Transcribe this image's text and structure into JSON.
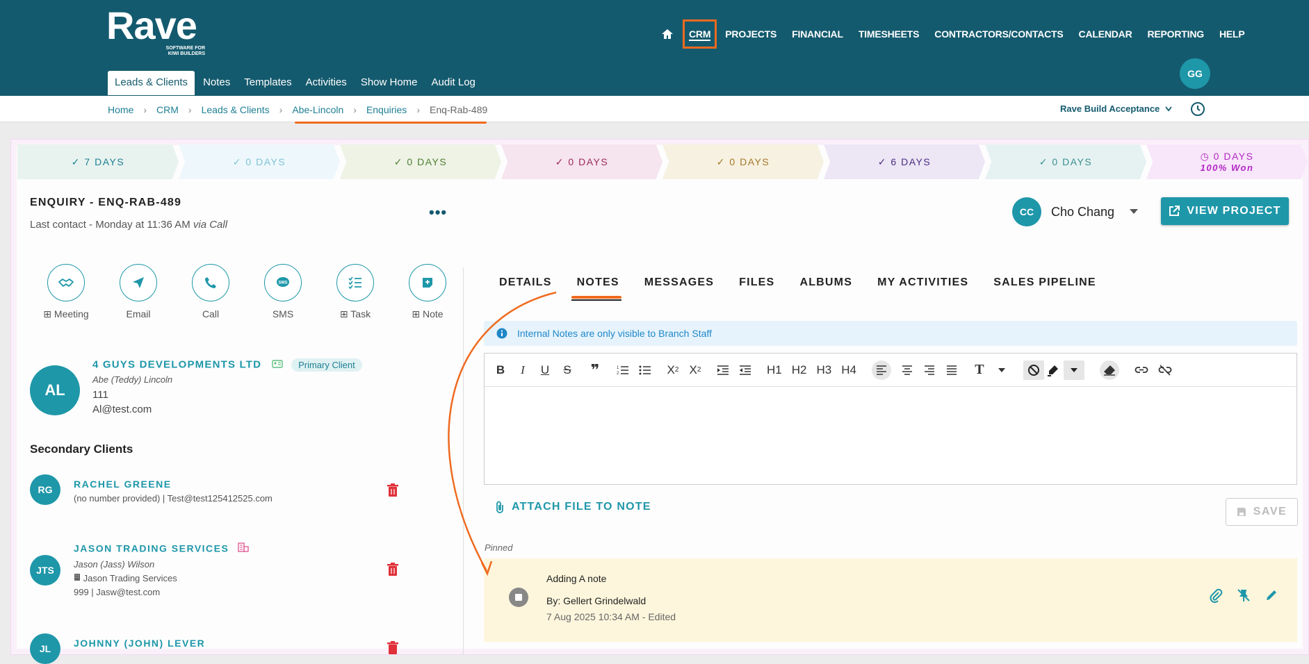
{
  "header": {
    "logo": "Rave",
    "logo_sub_1": "SOFTWARE FOR",
    "logo_sub_2": "KIWI BUILDERS",
    "nav": [
      "CRM",
      "PROJECTS",
      "FINANCIAL",
      "TIMESHEETS",
      "CONTRACTORS/CONTACTS",
      "CALENDAR",
      "REPORTING",
      "HELP"
    ],
    "subnav": [
      "Leads & Clients",
      "Notes",
      "Templates",
      "Activities",
      "Show Home",
      "Audit Log"
    ],
    "user_initials": "GG"
  },
  "breadcrumb": [
    "Home",
    "CRM",
    "Leads & Clients",
    "Abe-Lincoln",
    "Enquiries",
    "Enq-Rab-489"
  ],
  "branch": "Rave Build Acceptance",
  "pipeline": [
    {
      "label": "7 DAYS",
      "bg": "#e8f3ef",
      "color": "#1e7f93"
    },
    {
      "label": "0 DAYS",
      "bg": "#eef8fc",
      "color": "#7ec3d3"
    },
    {
      "label": "0 DAYS",
      "bg": "#eef3e6",
      "color": "#4f7d2e"
    },
    {
      "label": "0 DAYS",
      "bg": "#f6e4ef",
      "color": "#9a2a5a"
    },
    {
      "label": "0 DAYS",
      "bg": "#f6f1e0",
      "color": "#a4772a"
    },
    {
      "label": "6 DAYS",
      "bg": "#ece6f5",
      "color": "#4b2c84"
    },
    {
      "label": "0 DAYS",
      "bg": "#e6f2f2",
      "color": "#3c8f8f"
    },
    {
      "label": "0 DAYS",
      "label2": "100% Won",
      "bg": "#f8e6fa",
      "color": "#b228c4"
    }
  ],
  "enquiry": {
    "title": "ENQUIRY - ENQ-RAB-489",
    "last_contact": "Last contact - Monday at 11:36 AM",
    "via": "via Call"
  },
  "actions": [
    {
      "label": "Meeting",
      "plus": true
    },
    {
      "label": "Email",
      "plus": false
    },
    {
      "label": "Call",
      "plus": false
    },
    {
      "label": "SMS",
      "plus": false
    },
    {
      "label": "Task",
      "plus": true
    },
    {
      "label": "Note",
      "plus": true
    }
  ],
  "primary_client": {
    "initials": "AL",
    "name": "4 GUYS DEVELOPMENTS LTD",
    "badge": "Primary Client",
    "contact": "Abe (Teddy) Lincoln",
    "phone": "111",
    "email": "Al@test.com"
  },
  "secondary_heading": "Secondary Clients",
  "secondary_clients": [
    {
      "initials": "RG",
      "name": "RACHEL GREENE",
      "line": "(no number provided)  |  Test@test125412525.com"
    },
    {
      "initials": "JTS",
      "name": "JASON TRADING SERVICES",
      "sub": "Jason (Jass) Wilson",
      "company": "Jason Trading Services",
      "line": "999  |  Jasw@test.com"
    },
    {
      "initials": "JL",
      "name": "JOHNNY (JOHN) LEVER"
    }
  ],
  "owner": {
    "initials": "CC",
    "name": "Cho Chang"
  },
  "view_project": "VIEW PROJECT",
  "tabs": [
    "DETAILS",
    "NOTES",
    "MESSAGES",
    "FILES",
    "ALBUMS",
    "MY ACTIVITIES",
    "SALES PIPELINE"
  ],
  "info_text": "Internal Notes are only visible to Branch Staff",
  "toolbar_headings": [
    "H1",
    "H2",
    "H3",
    "H4"
  ],
  "attach_label": "ATTACH FILE TO NOTE",
  "save_label": "SAVE",
  "pinned_label": "Pinned",
  "note": {
    "title": "Adding A note",
    "by": "By: Gellert Grindelwald",
    "date": "7 Aug 2025 10:34 AM - Edited"
  },
  "colors": {
    "brand": "#145a6e",
    "accent": "#1e97a9",
    "highlight": "#ef6a1f",
    "danger": "#e0313a"
  }
}
